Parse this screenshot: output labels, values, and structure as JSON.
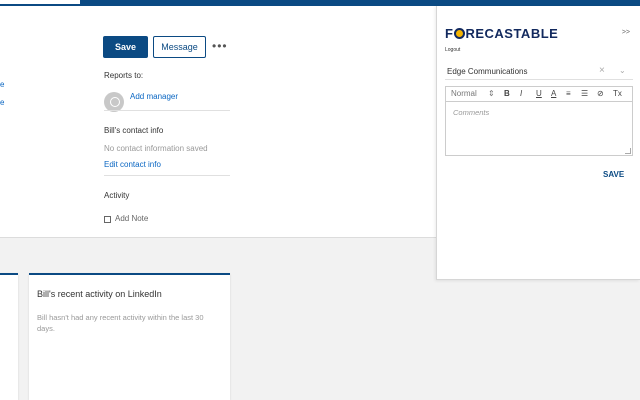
{
  "profile": {
    "save_label": "Save",
    "message_label": "Message",
    "more_label": "•••",
    "edge_link_1": "e",
    "edge_link_2": "e",
    "reports_to_label": "Reports to:",
    "add_manager_label": "Add manager",
    "contact_info_heading": "Bill's contact info",
    "no_contact_text": "No contact information saved",
    "edit_contact_label": "Edit contact info",
    "activity_heading": "Activity",
    "add_note_label": "Add Note"
  },
  "cards": {
    "recent_activity_title": "Bill's recent activity on LinkedIn",
    "recent_activity_body": "Bill hasn't had any recent activity within the last 30 days."
  },
  "panel": {
    "logo_prefix": "F",
    "logo_suffix": "RECASTABLE",
    "logout_label": "Logout",
    "collapse_label": ">>",
    "company_value": "Edge Communications",
    "clear_icon": "×",
    "dropdown_icon": "⌄",
    "toolbar": {
      "format_select": "Normal",
      "format_arrow": "⇕",
      "bold": "B",
      "italic": "I",
      "underline": "U",
      "strike": "A",
      "ordered_list": "≡",
      "bullet_list": "☰",
      "link": "⊘",
      "clear_format": "Tx"
    },
    "comments_placeholder": "Comments",
    "save_label": "SAVE"
  },
  "colors": {
    "brand_blue": "#0b4a83",
    "link_blue": "#0a66c2",
    "logo_navy": "#12295e",
    "logo_accent": "#f5b400"
  }
}
